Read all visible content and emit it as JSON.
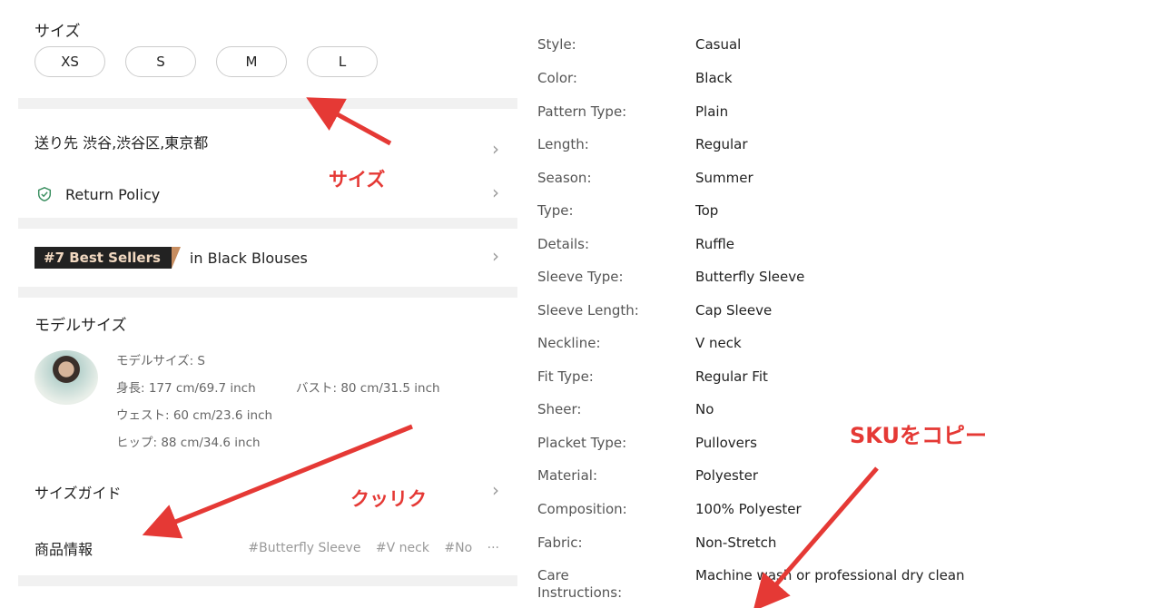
{
  "left": {
    "size_title": "サイズ",
    "sizes": [
      "XS",
      "S",
      "M",
      "L"
    ],
    "shipping": "送り先 渋谷,渋谷区,東京都",
    "return_policy": "Return Policy",
    "best_badge": "#7 Best Sellers",
    "best_category": "in Black Blouses",
    "model_title": "モデルサイズ",
    "model": {
      "size": "モデルサイズ: S",
      "height": "身長: 177 cm/69.7 inch",
      "bust": "バスト: 80 cm/31.5 inch",
      "waist": "ウェスト: 60 cm/23.6 inch",
      "hip": "ヒップ: 88 cm/34.6 inch"
    },
    "size_guide": "サイズガイド",
    "product_info": "商品情報",
    "tags": [
      "#Butterfly Sleeve",
      "#V neck",
      "#No",
      "···"
    ]
  },
  "annotations": {
    "size": "サイズ",
    "click": "クッリク",
    "sku": "SKUをコピー"
  },
  "specs": [
    {
      "label": "Style:",
      "value": "Casual"
    },
    {
      "label": "Color:",
      "value": "Black"
    },
    {
      "label": "Pattern Type:",
      "value": "Plain"
    },
    {
      "label": "Length:",
      "value": "Regular"
    },
    {
      "label": "Season:",
      "value": "Summer"
    },
    {
      "label": "Type:",
      "value": "Top"
    },
    {
      "label": "Details:",
      "value": "Ruffle"
    },
    {
      "label": "Sleeve Type:",
      "value": "Butterfly Sleeve"
    },
    {
      "label": "Sleeve Length:",
      "value": "Cap Sleeve"
    },
    {
      "label": "Neckline:",
      "value": "V neck"
    },
    {
      "label": "Fit Type:",
      "value": "Regular Fit"
    },
    {
      "label": "Sheer:",
      "value": "No"
    },
    {
      "label": "Placket Type:",
      "value": "Pullovers"
    },
    {
      "label": "Material:",
      "value": "Polyester"
    },
    {
      "label": "Composition:",
      "value": "100% Polyester"
    },
    {
      "label": "Fabric:",
      "value": "Non-Stretch"
    },
    {
      "label": "Care",
      "value": "Machine wash or professional dry clean"
    },
    {
      "label": "Instructions:",
      "value": ""
    }
  ],
  "colors": {
    "annotation": "#e53935",
    "badge_bg": "#222222",
    "badge_text": "#f1d8c0"
  },
  "icons": [
    "shield-check-icon",
    "chevron-right-icon",
    "arrow-icon"
  ]
}
